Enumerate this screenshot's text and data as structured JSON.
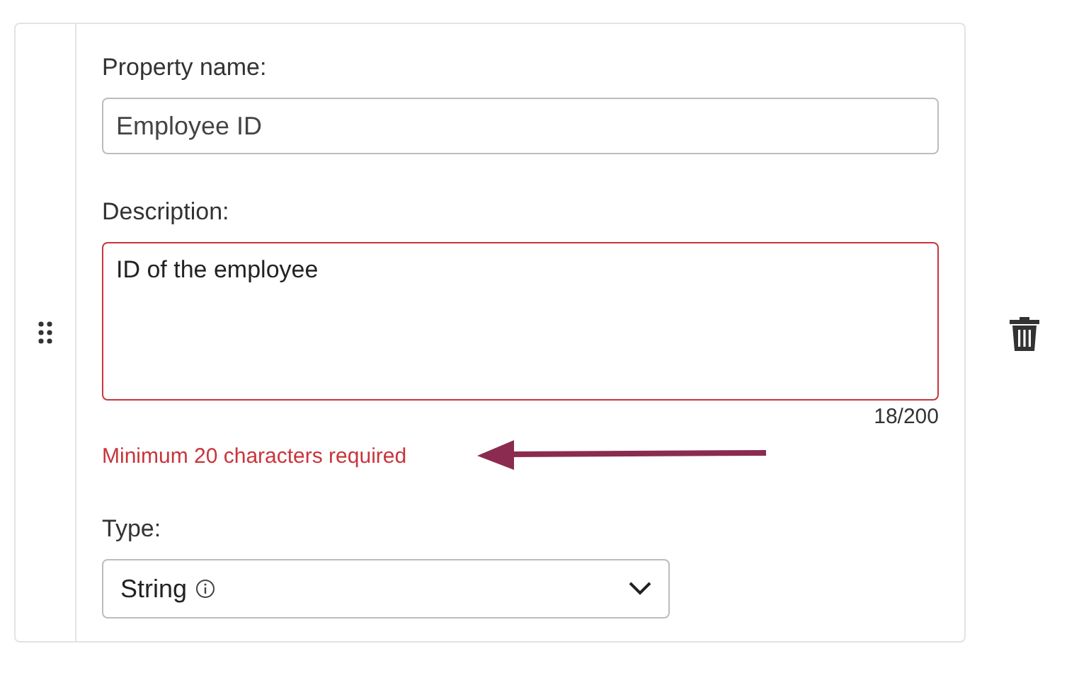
{
  "property_name": {
    "label": "Property name:",
    "value": "Employee ID"
  },
  "description": {
    "label": "Description:",
    "value": "ID of the employee",
    "counter": "18/200",
    "invalid": true,
    "error": "Minimum 20 characters required"
  },
  "type": {
    "label": "Type:",
    "value": "String"
  }
}
